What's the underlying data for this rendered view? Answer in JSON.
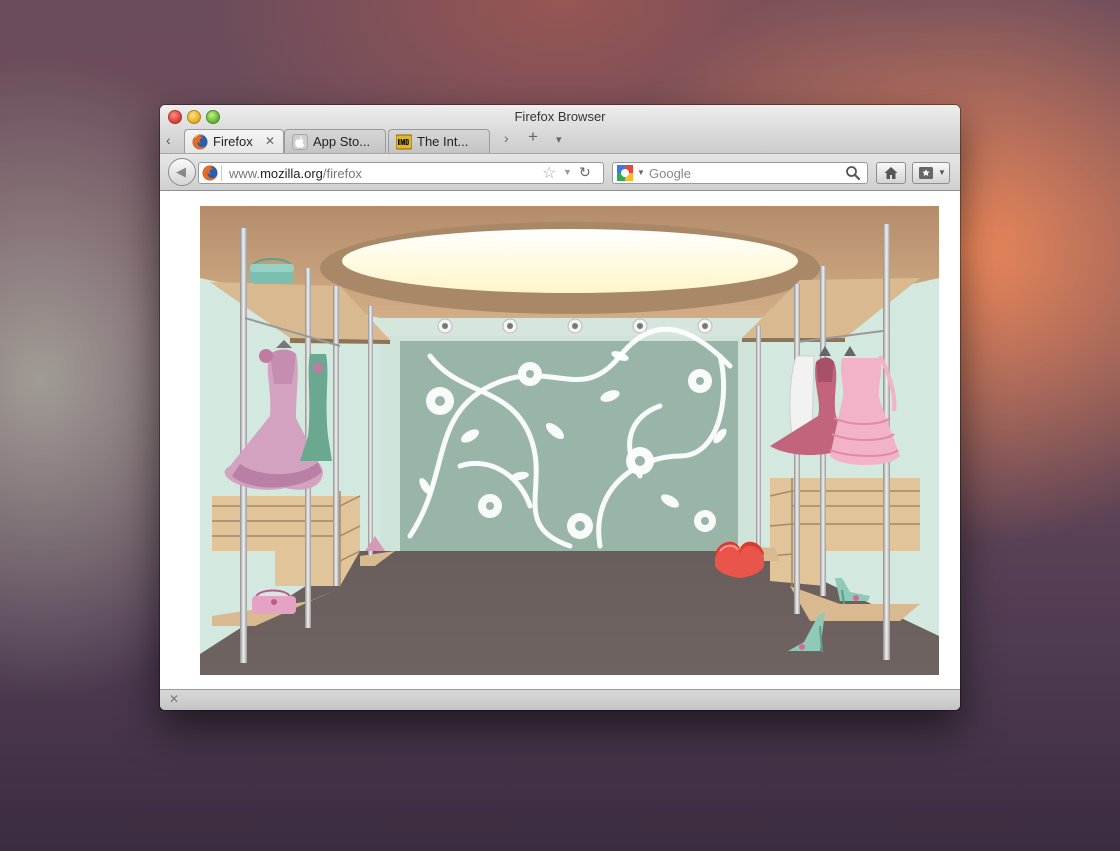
{
  "window": {
    "title": "Firefox Browser"
  },
  "tabs": [
    {
      "label": "Firefox",
      "close": "✕",
      "favicon": "firefox-icon",
      "active": true
    },
    {
      "label": "App Sto...",
      "favicon": "apple-icon",
      "active": false
    },
    {
      "label": "The Int...",
      "favicon": "imdb-icon",
      "active": false
    }
  ],
  "tab_controls": {
    "back": "‹",
    "scroll_right": "›",
    "new_tab": "+",
    "list_tabs": "▾"
  },
  "toolbar": {
    "back_glyph": "◀",
    "url_prefix": "www.",
    "url_domain": "mozilla.org",
    "url_path": "/firefox",
    "bookmark_star": "☆",
    "url_dropdown": "▼",
    "reload": "↻",
    "search_engine_dropdown": "▼",
    "search_placeholder": "Google"
  },
  "statusbar": {
    "close_glyph": "✕"
  },
  "colors": {
    "wall": "#d3e8de",
    "ceiling": "#c7a480",
    "floor": "#6d6160",
    "shelf_wood": "#d9b98f",
    "wallpaper": "#98b5a8"
  }
}
